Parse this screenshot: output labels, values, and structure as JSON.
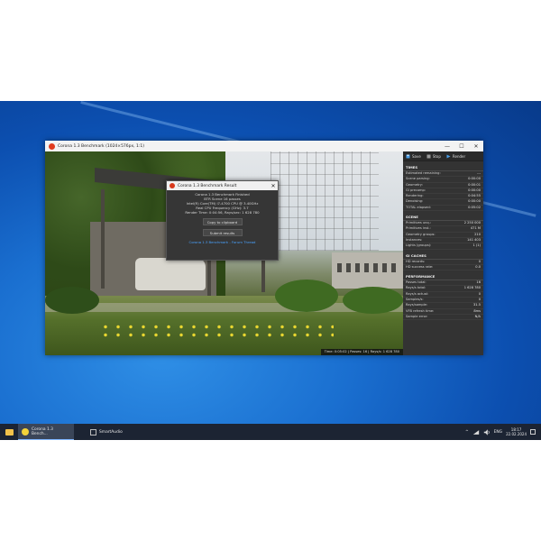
{
  "window": {
    "title": "Corona 1.3 Benchmark (1024×576px, 1:1)",
    "minimize": "—",
    "maximize": "☐",
    "close": "✕"
  },
  "toolbar": {
    "save": "Save",
    "stop": "Stop",
    "render": "Render"
  },
  "stats": {
    "times": {
      "heading": "TIMES",
      "rows": [
        {
          "label": "Estimated remaining:",
          "value": "---"
        },
        {
          "label": "Scene parsing:",
          "value": "0:00:00"
        },
        {
          "label": "Geometry:",
          "value": "0:00:01"
        },
        {
          "label": "GI precomp:",
          "value": "0:00:00"
        },
        {
          "label": "Rendering:",
          "value": "0:04:55"
        },
        {
          "label": "Denoising:",
          "value": "0:00:00"
        },
        {
          "label": "TOTAL elapsed:",
          "value": "0:05:02"
        }
      ]
    },
    "scene": {
      "heading": "SCENE",
      "rows": [
        {
          "label": "Primitives unq.:",
          "value": "2 250 000"
        },
        {
          "label": "Primitives inst.:",
          "value": "471 M"
        },
        {
          "label": "Geometry groups:",
          "value": "210"
        },
        {
          "label": "Instances:",
          "value": "141 403"
        },
        {
          "label": "Lights (groups):",
          "value": "1 (1)"
        }
      ]
    },
    "gi": {
      "heading": "GI CACHES",
      "rows": [
        {
          "label": "HD records:",
          "value": "0"
        },
        {
          "label": "HD success rate:",
          "value": "0.0"
        }
      ]
    },
    "perf": {
      "heading": "PERFORMANCE",
      "rows": [
        {
          "label": "Passes total:",
          "value": "16"
        },
        {
          "label": "Rays/s total:",
          "value": "1 628 780"
        },
        {
          "label": "Rays/s actual:",
          "value": "0"
        },
        {
          "label": "Samples/s:",
          "value": "0"
        },
        {
          "label": "Rays/sample:",
          "value": "31.5"
        },
        {
          "label": "VFB refresh time:",
          "value": "8ms"
        },
        {
          "label": "Sample error:",
          "value": "N/A"
        }
      ]
    }
  },
  "render_status": "Time: 0:05:02 | Passes: 16 | Rays/s: 1 628 780",
  "dialog": {
    "title": "Corona 1.3 Benchmark Result",
    "close": "✕",
    "lines": [
      "Corona 1.3 Benchmark Finished",
      "BTR Scene 16 passes",
      "Intel(R) Core(TM) i7-4700 CPU @ 3.40GHz",
      "Real CPU Frequency (GHz): 3.7",
      "Render Time: 0:04:56, Rays/sec: 1 628 780"
    ],
    "copy_button": "Copy to clipboard",
    "submit_button": "Submit results",
    "link": "Corona 1.3 Benchmark - Forum Thread"
  },
  "taskbar": {
    "app1": "Corona 1.3 Bench...",
    "app2": "SmartAudio",
    "tray_arrow": "^",
    "lang": "ENG",
    "time": "18:17",
    "date": "22.02.2024"
  }
}
